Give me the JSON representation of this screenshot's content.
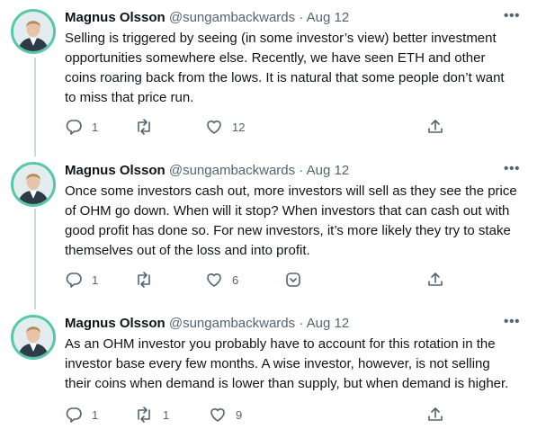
{
  "colors": {
    "text": "#0f1419",
    "muted": "#536471",
    "thread_line": "#cfd9de",
    "avatar_ring": "#56c8a8"
  },
  "tweets": [
    {
      "name": "Magnus Olsson",
      "handle": "@sungambackwards",
      "separator": "·",
      "date": "Aug 12",
      "more": "•••",
      "lines": [
        "Selling is triggered by seeing (in some investor’s view) better investment",
        "opportunities somewhere else. Recently, we have seen ETH and other",
        "coins roaring back from the lows. It is natural that some people don’t want",
        "to miss that price run."
      ],
      "replies": "1",
      "retweets": "",
      "likes": "12",
      "share_icon": "share-icon"
    },
    {
      "name": "Magnus Olsson",
      "handle": "@sungambackwards",
      "separator": "·",
      "date": "Aug 12",
      "more": "•••",
      "lines": [
        "Once some investors cash out, more investors will sell as they see the price",
        "of OHM go down. When will it stop? When investors that can cash out with",
        "good profit has done so. For new investors, it’s more likely they try to stake",
        "themselves out of the loss and into profit."
      ],
      "replies": "1",
      "retweets": "",
      "likes": "6",
      "share_icon": "tip-icon"
    },
    {
      "name": "Magnus Olsson",
      "handle": "@sungambackwards",
      "separator": "·",
      "date": "Aug 12",
      "more": "•••",
      "lines": [
        "As an OHM investor you probably have to account for this rotation in the",
        "investor base every few months. A wise investor, however, is not selling",
        "their coins when demand is lower than supply, but when demand is higher."
      ],
      "replies": "1",
      "retweets": "1",
      "likes": "9",
      "share_icon": "share-icon"
    }
  ]
}
